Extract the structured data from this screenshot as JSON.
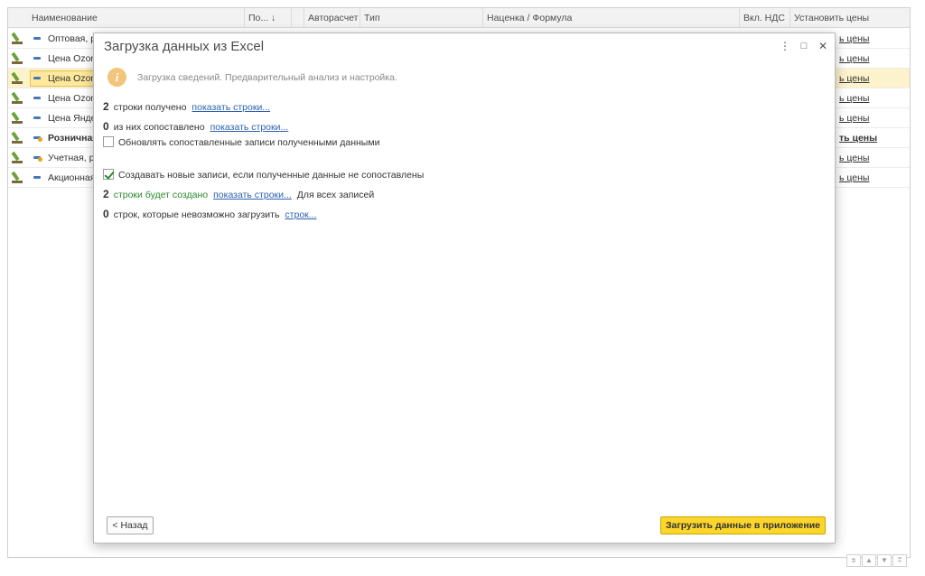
{
  "table": {
    "columns": [
      "Наименование",
      "По... ↓",
      "Авторасчет",
      "Тип",
      "Наценка / Формула",
      "Вкл. НДС",
      "Установить цены"
    ],
    "rows": [
      {
        "name": "Оптовая, р",
        "price_action": "ь цены",
        "selected": false,
        "bold": false,
        "marker": "plain"
      },
      {
        "name": "Цена Ozon",
        "price_action": "ь цены",
        "selected": false,
        "bold": false,
        "marker": "plain"
      },
      {
        "name": "Цена Ozon",
        "price_action": "ь цены",
        "selected": true,
        "bold": false,
        "marker": "plain"
      },
      {
        "name": "Цена Ozon",
        "price_action": "ь цены",
        "selected": false,
        "bold": false,
        "marker": "plain"
      },
      {
        "name": "Цена Янде",
        "price_action": "ь цены",
        "selected": false,
        "bold": false,
        "marker": "plain"
      },
      {
        "name": "Розничная",
        "price_action": "ть цены",
        "selected": false,
        "bold": true,
        "marker": "dot"
      },
      {
        "name": "Учетная, р.",
        "price_action": "ь цены",
        "selected": false,
        "bold": false,
        "marker": "dot"
      },
      {
        "name": "Акционная",
        "price_action": "ь цены",
        "selected": false,
        "bold": false,
        "marker": "plain"
      }
    ]
  },
  "pager": [
    "⩰",
    "▲",
    "▼",
    "⩱"
  ],
  "dialog": {
    "title": "Загрузка данных из Excel",
    "more_icon": "⋮",
    "maximize_icon": "□",
    "close_icon": "✕",
    "info_icon": "i",
    "info_text": "Загрузка сведений. Предварительный анализ и настройка.",
    "received": {
      "count": "2",
      "text": "строки получено",
      "link": "показать строки..."
    },
    "matched": {
      "count": "0",
      "text": "из них сопоставлено",
      "link": "показать строки..."
    },
    "update_checkbox": {
      "label": "Обновлять сопоставленные записи полученными данными",
      "checked": false
    },
    "create_checkbox": {
      "label": "Создавать новые записи, если полученные данные не сопоставлены",
      "checked": true
    },
    "to_create": {
      "count": "2",
      "text": "строки будет создано",
      "link": "показать строки...",
      "tail": "Для всех записей"
    },
    "cannot_load": {
      "count": "0",
      "text": "строк, которые невозможно загрузить",
      "link": "строк..."
    },
    "back_button": "< Назад",
    "load_button": "Загрузить данные в приложение"
  },
  "colors": {
    "accent_yellow": "#fcd62b",
    "link_blue": "#2c61b0",
    "green_text": "#2b8a2b",
    "selected_row": "#fcf2cc"
  }
}
